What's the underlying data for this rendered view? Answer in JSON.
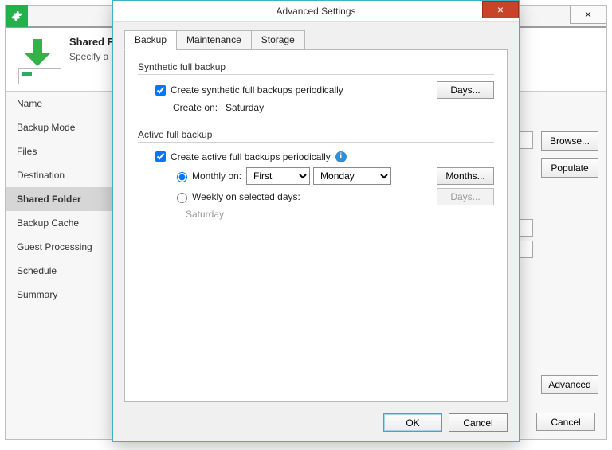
{
  "parent": {
    "header_title": "Shared F",
    "header_sub": "Specify a",
    "close_glyph": "×",
    "browse_label": "Browse...",
    "populate_label": "Populate",
    "advanced_label": "Advanced",
    "cancel_label": "Cancel",
    "sidebar": [
      "Name",
      "Backup Mode",
      "Files",
      "Destination",
      "Shared Folder",
      "Backup Cache",
      "Guest Processing",
      "Schedule",
      "Summary"
    ],
    "selected_index": 4
  },
  "dialog": {
    "title": "Advanced Settings",
    "close_glyph": "×",
    "tabs": [
      "Backup",
      "Maintenance",
      "Storage"
    ],
    "active_tab": 0,
    "synthetic": {
      "group_title": "Synthetic full backup",
      "checkbox_label": "Create synthetic full backups periodically",
      "checkbox_checked": true,
      "days_button": "Days...",
      "create_on_label": "Create on:",
      "create_on_value": "Saturday"
    },
    "active": {
      "group_title": "Active full backup",
      "checkbox_label": "Create active full backups periodically",
      "checkbox_checked": true,
      "monthly_label": "Monthly on:",
      "monthly_selected": true,
      "ordinal_value": "First",
      "weekday_value": "Monday",
      "months_button": "Months...",
      "weekly_label": "Weekly on selected days:",
      "weekly_selected": false,
      "weekly_days_button": "Days...",
      "weekly_value": "Saturday"
    },
    "ok_label": "OK",
    "cancel_label": "Cancel"
  }
}
